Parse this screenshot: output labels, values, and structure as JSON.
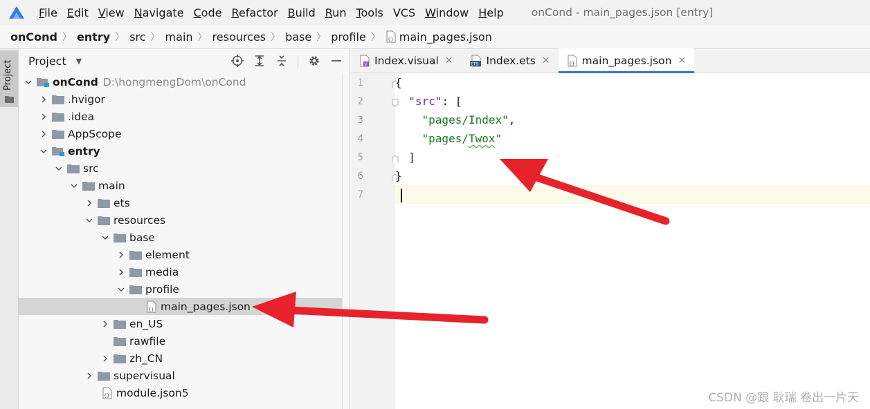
{
  "menubar": {
    "items": [
      {
        "mnemonic": "F",
        "rest": "ile"
      },
      {
        "mnemonic": "E",
        "rest": "dit"
      },
      {
        "mnemonic": "V",
        "rest": "iew"
      },
      {
        "mnemonic": "N",
        "rest": "avigate"
      },
      {
        "mnemonic": "C",
        "rest": "ode"
      },
      {
        "mnemonic": "R",
        "rest": "efactor"
      },
      {
        "mnemonic": "B",
        "rest": "uild"
      },
      {
        "mnemonic": "R",
        "rest": "un"
      },
      {
        "mnemonic": "T",
        "rest": "ools"
      },
      {
        "mnemonic": "",
        "rest": "VCS"
      },
      {
        "mnemonic": "W",
        "rest": "indow"
      },
      {
        "mnemonic": "H",
        "rest": "elp"
      }
    ],
    "window_title": "onCond - main_pages.json [entry]"
  },
  "breadcrumb": [
    "onCond",
    "entry",
    "src",
    "main",
    "resources",
    "base",
    "profile",
    "main_pages.json"
  ],
  "toolstrip": {
    "label": "Project"
  },
  "project_panel": {
    "title": "Project",
    "tree": [
      {
        "label": "onCond",
        "path": "D:\\hongmengDom\\onCond",
        "bold": true,
        "expanded": true,
        "icon": "module-folder-icon"
      },
      {
        "label": ".hvigor",
        "expanded": false,
        "icon": "folder-icon"
      },
      {
        "label": ".idea",
        "expanded": false,
        "icon": "folder-icon"
      },
      {
        "label": "AppScope",
        "expanded": false,
        "icon": "folder-icon"
      },
      {
        "label": "entry",
        "bold": true,
        "expanded": true,
        "icon": "module-folder-icon"
      },
      {
        "label": "src",
        "expanded": true,
        "icon": "folder-icon"
      },
      {
        "label": "main",
        "expanded": true,
        "icon": "folder-icon"
      },
      {
        "label": "ets",
        "expanded": false,
        "icon": "folder-icon"
      },
      {
        "label": "resources",
        "expanded": true,
        "icon": "folder-icon"
      },
      {
        "label": "base",
        "expanded": true,
        "icon": "folder-icon"
      },
      {
        "label": "element",
        "expanded": false,
        "icon": "folder-icon"
      },
      {
        "label": "media",
        "expanded": false,
        "icon": "folder-icon"
      },
      {
        "label": "profile",
        "expanded": true,
        "icon": "folder-icon"
      },
      {
        "label": "main_pages.json",
        "selected": true,
        "icon": "json-file-icon"
      },
      {
        "label": "en_US",
        "expanded": false,
        "icon": "folder-icon"
      },
      {
        "label": "rawfile",
        "icon": "folder-icon"
      },
      {
        "label": "zh_CN",
        "expanded": false,
        "icon": "folder-icon"
      },
      {
        "label": "supervisual",
        "expanded": false,
        "icon": "folder-icon"
      },
      {
        "label": "module.json5",
        "icon": "json-file-icon"
      }
    ]
  },
  "editor": {
    "tabs": [
      {
        "label": "Index.visual",
        "icon": "visual-file-icon",
        "active": false
      },
      {
        "label": "Index.ets",
        "icon": "ets-file-icon",
        "active": false
      },
      {
        "label": "main_pages.json",
        "icon": "json-file-icon",
        "active": true
      }
    ],
    "line_numbers": [
      "1",
      "2",
      "3",
      "4",
      "5",
      "6",
      "7"
    ],
    "code": {
      "l1": "{",
      "l2_key": "\"src\"",
      "l2_rest": ": [",
      "l3_str": "\"pages/Index\"",
      "l3_rest": ",",
      "l4_str_a": "\"pages/",
      "l4_str_b": "Twox",
      "l4_str_c": "\"",
      "l5": "]",
      "l6": "}"
    }
  },
  "watermark": "CSDN @跟 耿瑞 卷出一片天",
  "colors": {
    "accent_tab": "#3874d8",
    "annotation_arrow": "#e8222b",
    "selection": "#d5d5d5"
  }
}
